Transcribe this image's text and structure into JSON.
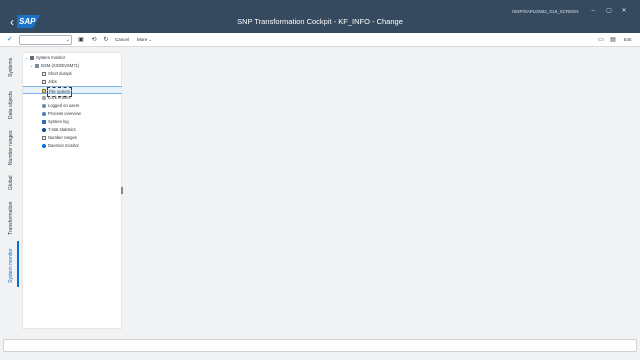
{
  "shell": {
    "title": "SNP Transformation Cockpit - KF_INFO - Change",
    "system_info": "/SNP/SAPLDN02_GUI_SCREEN",
    "logo_text": "SAP"
  },
  "toolbar": {
    "command_value": "",
    "cancel_label": "Cancel",
    "more_label": "More",
    "exit_label": "Exit"
  },
  "vertical_tabs": [
    {
      "label": "Systems"
    },
    {
      "label": "Data objects"
    },
    {
      "label": "Number ranges"
    },
    {
      "label": "Global"
    },
    {
      "label": "Transformation"
    },
    {
      "label": "System monitor"
    }
  ],
  "tree": {
    "root": "System monitor",
    "server": "DSM (XXDEVSM71)",
    "items": [
      {
        "label": "Short dumps",
        "icon": "dump-icon"
      },
      {
        "label": "Jobs",
        "icon": "jobs-icon"
      },
      {
        "label": "File system",
        "icon": "folder-icon"
      },
      {
        "label": "Lock entries",
        "icon": "lock-icon"
      },
      {
        "label": "Logged on users",
        "icon": "user-icon"
      },
      {
        "label": "Process overview",
        "icon": "process-icon"
      },
      {
        "label": "System log",
        "icon": "log-icon"
      },
      {
        "label": "T-stat statistics",
        "icon": "statistics-icon"
      },
      {
        "label": "Number ranges",
        "icon": "number-ranges-icon"
      },
      {
        "label": "Daemon monitor",
        "icon": "daemon-icon"
      }
    ],
    "selected": "File system"
  },
  "colors": {
    "shell_bg": "#354a5f",
    "accent": "#0a6ed1",
    "page_bg": "#f1f2f3"
  }
}
